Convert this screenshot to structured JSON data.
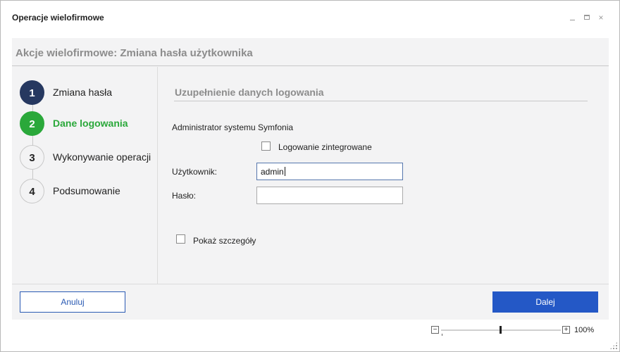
{
  "window": {
    "title": "Operacje wielofirmowe",
    "controls": {
      "minimize": "minimize-icon",
      "maximize": "maximize-icon",
      "close": "×"
    }
  },
  "header": {
    "title": "Akcje wielofirmowe: Zmiana hasła użytkownika"
  },
  "steps": [
    {
      "number": "1",
      "label": "Zmiana hasła",
      "state": "done"
    },
    {
      "number": "2",
      "label": "Dane logowania",
      "state": "active"
    },
    {
      "number": "3",
      "label": "Wykonywanie operacji",
      "state": "todo"
    },
    {
      "number": "4",
      "label": "Podsumowanie",
      "state": "todo"
    }
  ],
  "form": {
    "section_title": "Uzupełnienie danych logowania",
    "admin_label": "Administrator systemu Symfonia",
    "integrated_login_label": "Logowanie zintegrowane",
    "integrated_login_checked": false,
    "user_label": "Użytkownik:",
    "user_value": "admin",
    "password_label": "Hasło:",
    "password_value": "",
    "show_details_label": "Pokaż szczegóły",
    "show_details_checked": false
  },
  "footer": {
    "cancel_label": "Anuluj",
    "next_label": "Dalej"
  },
  "zoom": {
    "minus": "−",
    "plus": "+",
    "level": "100%"
  },
  "colors": {
    "accent": "#2458c6",
    "step_done": "#263860",
    "step_active": "#2aa83a"
  }
}
